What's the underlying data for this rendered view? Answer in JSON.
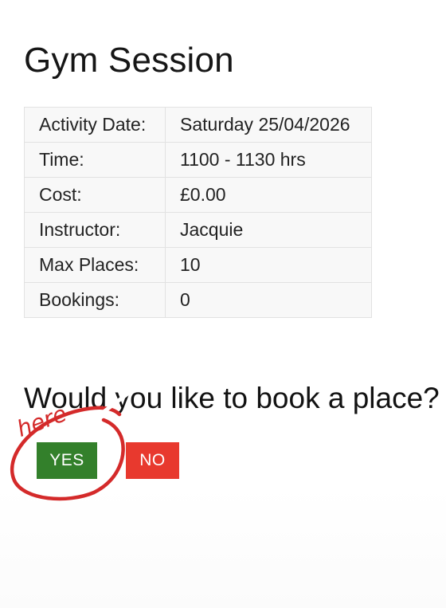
{
  "page": {
    "title": "Gym Session"
  },
  "details": [
    {
      "label": "Activity Date:",
      "value": "Saturday 25/04/2026"
    },
    {
      "label": "Time:",
      "value": "1100 - 1130 hrs"
    },
    {
      "label": "Cost:",
      "value": "£0.00"
    },
    {
      "label": "Instructor:",
      "value": "Jacquie"
    },
    {
      "label": "Max Places:",
      "value": "10"
    },
    {
      "label": "Bookings:",
      "value": "0"
    }
  ],
  "booking": {
    "question": "Would you like to book a place?",
    "yes_label": "YES",
    "no_label": "NO"
  },
  "annotation": {
    "text": "here",
    "color": "#d42a2a"
  },
  "colors": {
    "yes_button": "#33802b",
    "no_button": "#e8392e"
  }
}
